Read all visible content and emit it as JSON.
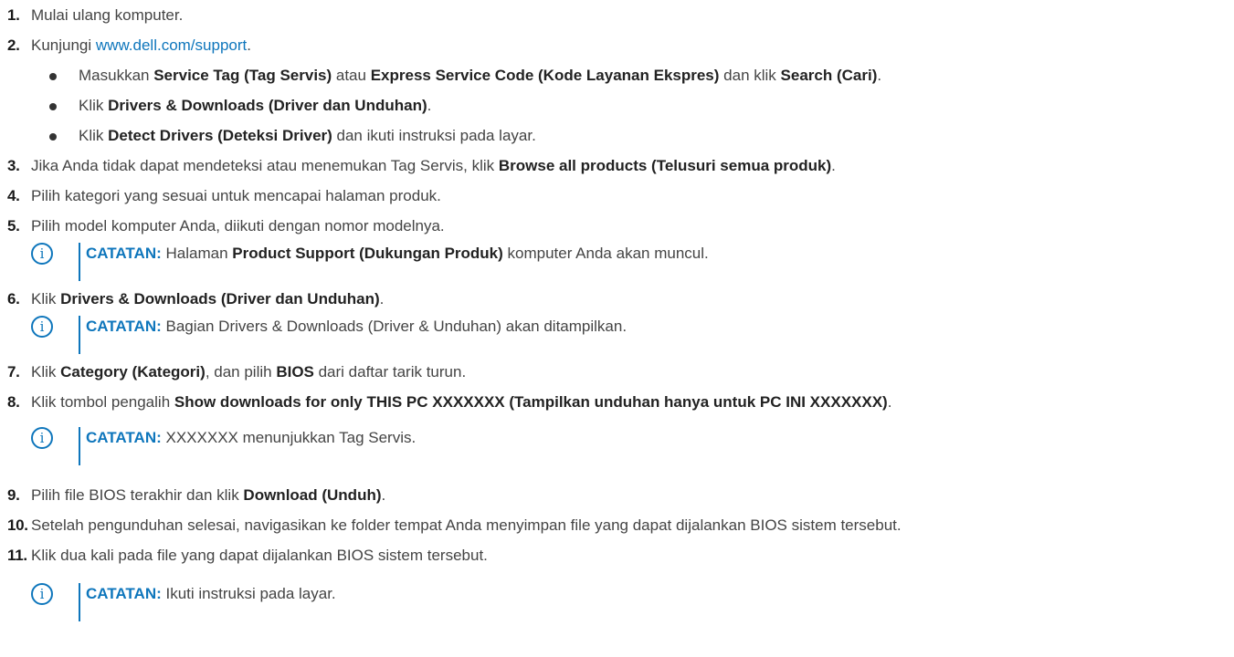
{
  "steps": [
    {
      "num": "1.",
      "text": "Mulai ulang komputer."
    },
    {
      "num": "2.",
      "text_before": "Kunjungi ",
      "link": "www.dell.com/support",
      "text_after": "."
    },
    {
      "num": "3.",
      "text": "Jika Anda tidak dapat mendeteksi atau menemukan Tag Servis, klik ",
      "bold": "Browse all products (Telusuri semua produk)",
      "after": "."
    },
    {
      "num": "4.",
      "text": "Pilih kategori yang sesuai untuk mencapai halaman produk."
    },
    {
      "num": "5.",
      "text": "Pilih model komputer Anda, diikuti dengan nomor modelnya."
    },
    {
      "num": "6.",
      "text": "Klik ",
      "bold": "Drivers & Downloads (Driver dan Unduhan)",
      "after": "."
    },
    {
      "num": "7.",
      "text": "Klik ",
      "bold": "Category (Kategori)",
      "mid": ", dan pilih ",
      "bold2": "BIOS",
      "after": " dari daftar tarik turun."
    },
    {
      "num": "8.",
      "text": "Klik tombol pengalih ",
      "bold": "Show downloads for only THIS PC XXXXXXX (Tampilkan unduhan hanya untuk PC INI XXXXXXX)",
      "after": "."
    },
    {
      "num": "9.",
      "text": "Pilih file BIOS terakhir dan klik ",
      "bold": "Download (Unduh)",
      "after": "."
    },
    {
      "num": "10.",
      "text": "Setelah pengunduhan selesai, navigasikan ke folder tempat Anda menyimpan file yang dapat dijalankan BIOS sistem tersebut."
    },
    {
      "num": "11.",
      "text": "Klik dua kali pada file yang dapat dijalankan BIOS sistem tersebut."
    }
  ],
  "substeps": [
    {
      "text": "Masukkan ",
      "bold1": "Service Tag (Tag Servis)",
      "mid1": " atau ",
      "bold2": "Express Service Code (Kode Layanan Ekspres)",
      "mid2": " dan klik ",
      "bold3": "Search (Cari)",
      "after": "."
    },
    {
      "text": "Klik ",
      "bold": "Drivers & Downloads (Driver dan Unduhan)",
      "after": "."
    },
    {
      "text": "Klik ",
      "bold": "Detect Drivers (Deteksi Driver)",
      "after": " dan ikuti instruksi pada layar."
    }
  ],
  "notes": [
    {
      "label": "CATATAN:",
      "text": " Halaman ",
      "bold": "Product Support (Dukungan Produk)",
      "after": " komputer Anda akan muncul."
    },
    {
      "label": "CATATAN:",
      "text": " Bagian Drivers & Downloads (Driver & Unduhan) akan ditampilkan."
    },
    {
      "label": "CATATAN:",
      "text": " XXXXXXX menunjukkan Tag Servis."
    },
    {
      "label": "CATATAN:",
      "text": " Ikuti instruksi pada layar."
    }
  ],
  "note_icon_glyph": "i",
  "colors": {
    "accent": "#0e76bc",
    "text": "#444444",
    "number": "#1a1a1a"
  }
}
